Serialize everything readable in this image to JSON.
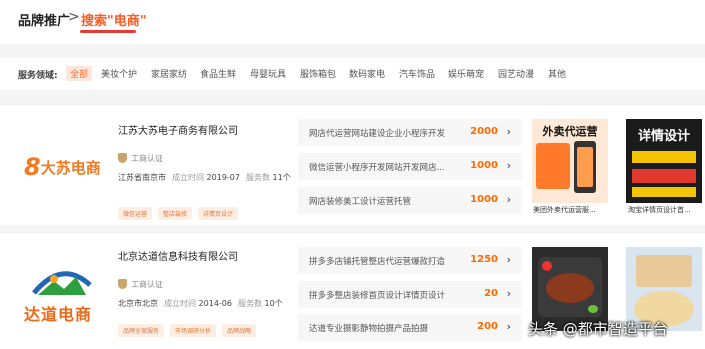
{
  "breadcrumb": {
    "root": "品牌推广",
    "separator": ">",
    "current": "搜索\"电商\""
  },
  "filters": {
    "label": "服务领域:",
    "items": [
      "全部",
      "美妆个护",
      "家居家纺",
      "食品生鲜",
      "母婴玩具",
      "服饰箱包",
      "数码家电",
      "汽车饰品",
      "娱乐萌宠",
      "园艺动漫",
      "其他"
    ],
    "active_index": 0
  },
  "companies": [
    {
      "logo_text": "大苏电商",
      "logo_mark": "8",
      "name": "江苏大苏电子商务有限公司",
      "verification": "工商认证",
      "location": "江苏省南京市",
      "established_label": "成立时间",
      "established": "2019-07",
      "service_count_label": "服务数",
      "service_count": "11个",
      "tags": [
        "微信运营",
        "整店装修",
        "详情页设计"
      ],
      "services": [
        {
          "name": "网店代运营网站建设企业小程序开发",
          "price": "2000"
        },
        {
          "name": "微信运营小程序开发网站开发网店...",
          "price": "1000"
        },
        {
          "name": "网店装修美工设计运营托管",
          "price": "1000"
        }
      ],
      "cases": [
        {
          "caption": "美团外卖代运营服...",
          "art_title": "外卖代运营"
        },
        {
          "caption": "淘宝详情页设计首...",
          "art_title": "详情设计"
        }
      ]
    },
    {
      "logo_text": "达道电商",
      "name": "北京达道信息科技有限公司",
      "verification": "工商认证",
      "location": "北京市北京",
      "established_label": "成立时间",
      "established": "2014-06",
      "service_count_label": "服务数",
      "service_count": "10个",
      "tags": [
        "品牌全案服务",
        "市场调研分析",
        "品牌战略"
      ],
      "services": [
        {
          "name": "拼多多店铺托管整店代运营爆款打造",
          "price": "1250"
        },
        {
          "name": "拼多多整店装修首页设计详情页设计",
          "price": "20"
        },
        {
          "name": "达道专业摄影静物拍摄产品拍摄",
          "price": "200"
        }
      ]
    }
  ],
  "watermark": "头条 @都市智造平台",
  "colors": {
    "accent": "#ff6a00",
    "crumb_underline": "#e53935",
    "tag_bg": "#fdeee4",
    "logo_orange": "#f47a1f",
    "logo_green": "#2f9e41",
    "logo_blue": "#2366b5"
  }
}
